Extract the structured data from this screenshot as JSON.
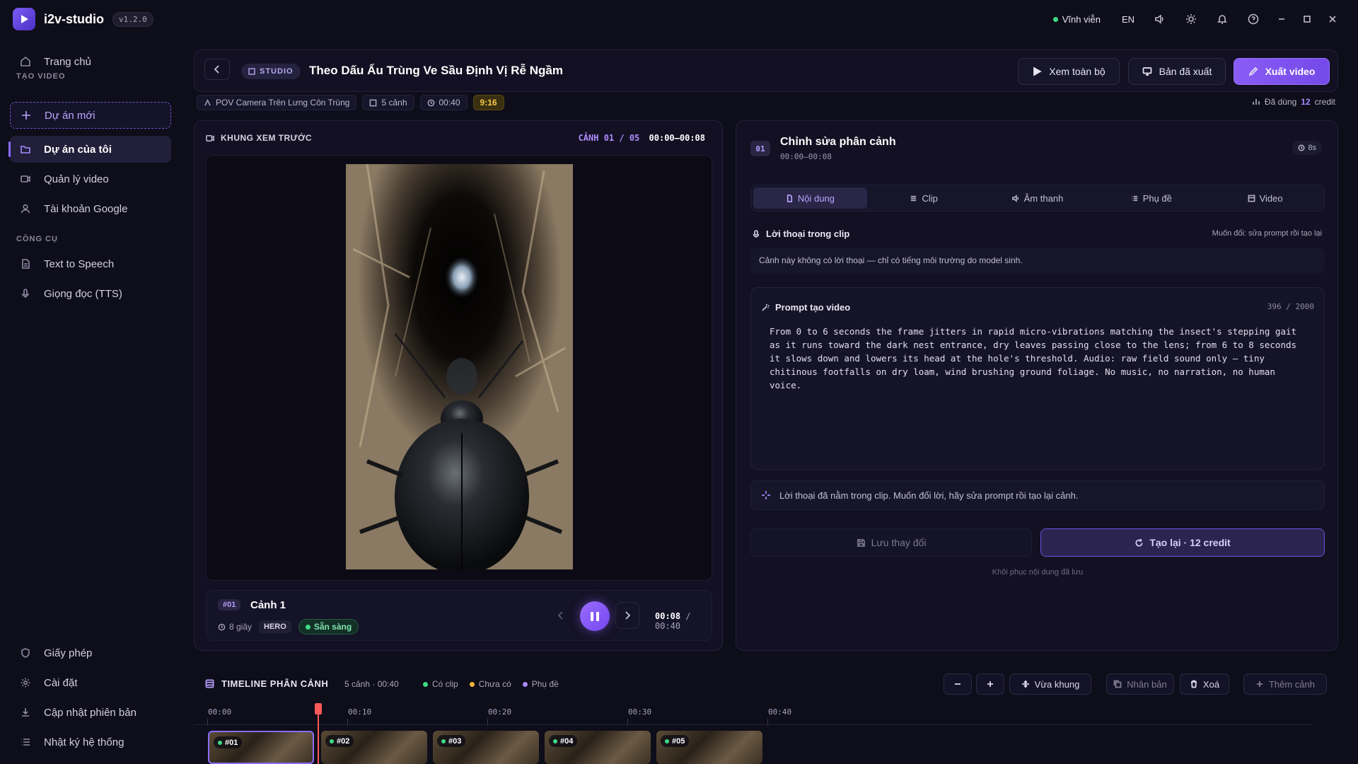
{
  "app": {
    "name": "i2v-studio",
    "version": "v1.2.0",
    "license_status": "Vĩnh viễn",
    "language": "EN"
  },
  "sidebar": {
    "home": "Trang chủ",
    "section_create": "TẠO VIDEO",
    "new_project": "Dự án mới",
    "my_projects": "Dự án của tôi",
    "manage_video": "Quản lý video",
    "google_account": "Tài khoản Google",
    "section_tools": "CÔNG CỤ",
    "tts": "Text to Speech",
    "voices": "Giọng đọc (TTS)",
    "license": "Giấy phép",
    "settings": "Cài đặt",
    "update": "Cập nhật phiên bản",
    "logs": "Nhật ký hệ thống"
  },
  "header": {
    "badge": "STUDIO",
    "title": "Theo Dấu Ấu Trùng Ve Sầu Định Vị Rễ Ngầm",
    "view_all": "Xem toàn bộ",
    "exported": "Bản đã xuất",
    "export": "Xuất video"
  },
  "meta": {
    "camera": "POV Camera Trên Lưng Côn Trùng",
    "scenes": "5 cảnh",
    "duration": "00:40",
    "ratio": "9:16",
    "credit_used_prefix": "Đã dùng",
    "credit_used_value": "12",
    "credit_used_suffix": "credit"
  },
  "preview": {
    "label": "KHUNG XEM TRƯỚC",
    "scene_counter": "CẢNH 01 / 05",
    "scene_range": "00:00–00:08",
    "scene_num": "#01",
    "scene_name": "Cảnh 1",
    "scene_duration": "8 giây",
    "hero": "HERO",
    "status": "Sẵn sàng",
    "time_current": "00:08",
    "time_sep": "/",
    "time_total": "00:40"
  },
  "editor": {
    "num": "01",
    "title": "Chỉnh sửa phân cảnh",
    "range": "00:00–00:08",
    "duration": "8s",
    "tabs": [
      "Nội dung",
      "Clip",
      "Âm thanh",
      "Phụ đề",
      "Video"
    ],
    "dialog_label": "Lời thoại trong clip",
    "dialog_hint": "Muốn đổi: sửa prompt rồi tạo lại",
    "dialog_text": "Cảnh này không có lời thoại — chỉ có tiếng môi trường do model sinh.",
    "prompt_label": "Prompt tạo video",
    "prompt_count": "396 / 2000",
    "prompt_text": "From 0 to 6 seconds the frame jitters in rapid micro-vibrations matching the insect's stepping gait\nas it runs toward the dark nest entrance, dry leaves passing close to the lens; from 6 to 8 seconds\nit slows down and lowers its head at the hole's threshold. Audio: raw field sound only — tiny\nchitinous footfalls on dry loam, wind brushing ground foliage. No music, no narration, no human\nvoice.",
    "note": "Lời thoại đã nằm trong clip. Muốn đổi lời, hãy sửa prompt rồi tạo lại cảnh.",
    "save": "Lưu thay đổi",
    "regen": "Tạo lại · 12 credit",
    "restore": "Khôi phục nội dung đã lưu"
  },
  "timeline": {
    "title": "TIMELINE PHÂN CẢNH",
    "summary": "5 cảnh · 00:40",
    "legend": [
      {
        "label": "Có clip",
        "color": "#3ddc84"
      },
      {
        "label": "Chưa có",
        "color": "#f3b63a"
      },
      {
        "label": "Phụ đề",
        "color": "#a98bff"
      }
    ],
    "fit": "Vừa khung",
    "duplicate": "Nhân bản",
    "delete": "Xoá",
    "add": "Thêm cảnh",
    "ticks": [
      "00:00",
      "00:10",
      "00:20",
      "00:30",
      "00:40"
    ],
    "clips": [
      "#01",
      "#02",
      "#03",
      "#04",
      "#05"
    ]
  }
}
